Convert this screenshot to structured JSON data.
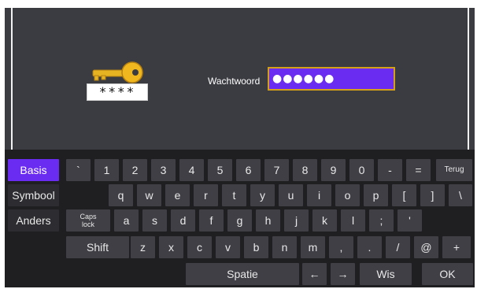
{
  "login": {
    "password_label": "Wachtwoord",
    "password_value": "●●●●●●",
    "key_icon_mask": "****"
  },
  "keyboard": {
    "modes": [
      "Basis",
      "Symbool",
      "Anders"
    ],
    "row1": [
      "`",
      "1",
      "2",
      "3",
      "4",
      "5",
      "6",
      "7",
      "8",
      "9",
      "0",
      "-",
      "="
    ],
    "back_label": "Terug",
    "row2": [
      "q",
      "w",
      "e",
      "r",
      "t",
      "y",
      "u",
      "i",
      "o",
      "p",
      "[",
      "]",
      "\\"
    ],
    "caps_label": "Caps\nlock",
    "row3": [
      "a",
      "s",
      "d",
      "f",
      "g",
      "h",
      "j",
      "k",
      "l",
      ";",
      "'"
    ],
    "shift_label": "Shift",
    "row4": [
      "z",
      "x",
      "c",
      "v",
      "b",
      "n",
      "m",
      ",",
      ".",
      "/",
      "@",
      "+"
    ],
    "space_label": "Spatie",
    "left_arrow": "←",
    "right_arrow": "→",
    "clear_label": "Wis",
    "ok_label": "OK"
  },
  "colors": {
    "background": "#3b3c41",
    "accent": "#6a2cf0",
    "field_border": "#d4a017"
  }
}
